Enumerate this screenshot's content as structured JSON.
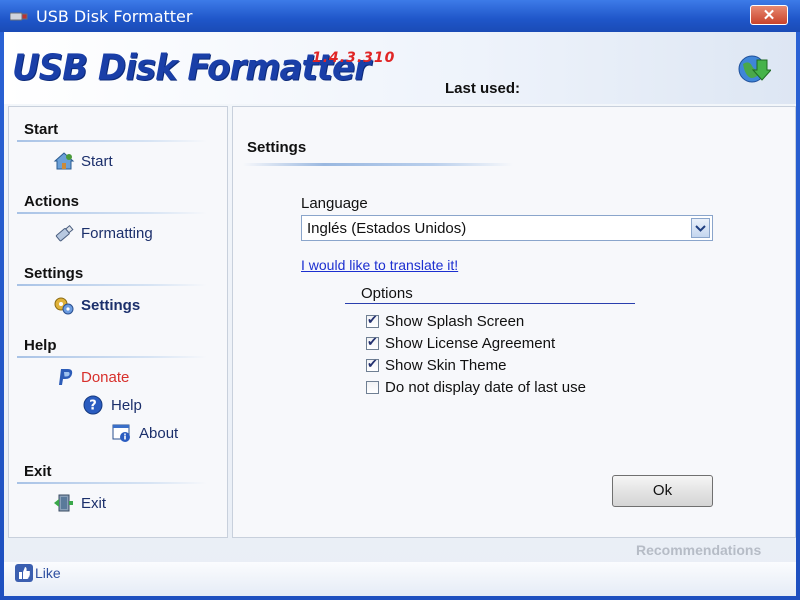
{
  "window": {
    "title": "USB Disk Formatter",
    "close_label": "✕"
  },
  "banner": {
    "logo": "USB Disk Formatter",
    "version": "1.4.3.310",
    "last_used_label": "Last used:"
  },
  "sidebar": {
    "sections": [
      {
        "title": "Start",
        "items": [
          {
            "label": "Start",
            "icon": "house-icon"
          }
        ]
      },
      {
        "title": "Actions",
        "items": [
          {
            "label": "Formatting",
            "icon": "usb-drive-icon"
          }
        ]
      },
      {
        "title": "Settings",
        "items": [
          {
            "label": "Settings",
            "icon": "gears-icon"
          }
        ]
      },
      {
        "title": "Help",
        "items": [
          {
            "label": "Donate",
            "icon": "paypal-icon"
          },
          {
            "label": "Help",
            "icon": "help-icon"
          },
          {
            "label": "About",
            "icon": "about-icon"
          }
        ]
      },
      {
        "title": "Exit",
        "items": [
          {
            "label": "Exit",
            "icon": "exit-door-icon"
          }
        ]
      }
    ]
  },
  "settings": {
    "title": "Settings",
    "language_label": "Language",
    "language_value": "Inglés (Estados Unidos)",
    "translate_link": "I would like to translate it!",
    "options_label": "Options",
    "options": [
      {
        "label": "Show Splash Screen",
        "checked": true
      },
      {
        "label": "Show License Agreement",
        "checked": true
      },
      {
        "label": "Show Skin Theme",
        "checked": true
      },
      {
        "label": "Do not display date of last use",
        "checked": false
      }
    ],
    "ok_label": "Ok"
  },
  "footer": {
    "recommendations": "Recommendations",
    "like": "Like"
  },
  "colors": {
    "titlebar": "#1f56c9",
    "logo": "#1a3fa8",
    "version": "#e02525",
    "donate": "#d8302c",
    "link": "#1c2fd0"
  }
}
